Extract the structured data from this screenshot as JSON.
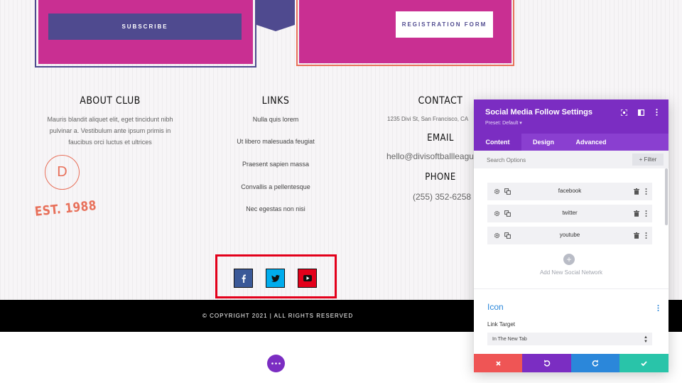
{
  "cards": {
    "subscribe_label": "SUBSCRIBE",
    "registration_label": "REGISTRATION FORM"
  },
  "footer": {
    "about": {
      "title": "ABOUT CLUB",
      "text_lines": [
        "Mauris blandit aliquet elit, eget tincidunt nibh",
        "pulvinar a. Vestibulum ante ipsum primis in",
        "faucibus orci luctus et ultrices"
      ],
      "badge_letter": "D",
      "est": "EST. 1988"
    },
    "links": {
      "title": "LINKS",
      "items": [
        "Nulla quis lorem",
        "Ut libero malesuada feugiat",
        "Praesent sapien massa",
        "Convallis a pellentesque",
        "Nec egestas non nisi"
      ]
    },
    "contact": {
      "title": "CONTACT",
      "address": "1235 Divi St, San Francisco, CA",
      "email_title": "EMAIL",
      "email": "hello@divisoftballleague",
      "phone_title": "PHONE",
      "phone": "(255) 352-6258"
    }
  },
  "social": {
    "icons": [
      "facebook-icon",
      "twitter-icon",
      "youtube-icon"
    ],
    "colors": {
      "facebook": "#3b5998",
      "twitter": "#00aced",
      "youtube": "#e3001b",
      "highlight": "#e3001b"
    }
  },
  "copyright": "© COPYRIGHT 2021 | ALL RIGHTS RESERVED",
  "panel": {
    "title": "Social Media Follow Settings",
    "preset": "Preset: Default ▾",
    "tabs": [
      "Content",
      "Design",
      "Advanced"
    ],
    "search_placeholder": "Search Options",
    "filter_label": "+ Filter",
    "networks": [
      "facebook",
      "twitter",
      "youtube"
    ],
    "add_label": "Add New Social Network",
    "icon_section": "Icon",
    "link_target_label": "Link Target",
    "link_target_value": "In The New Tab",
    "colors": {
      "header": "#7b2dc2",
      "accent": "#2b87da",
      "cancel": "#ef5555",
      "undo": "#7b2dc2",
      "redo": "#2b87da",
      "save": "#29c4a9"
    }
  }
}
